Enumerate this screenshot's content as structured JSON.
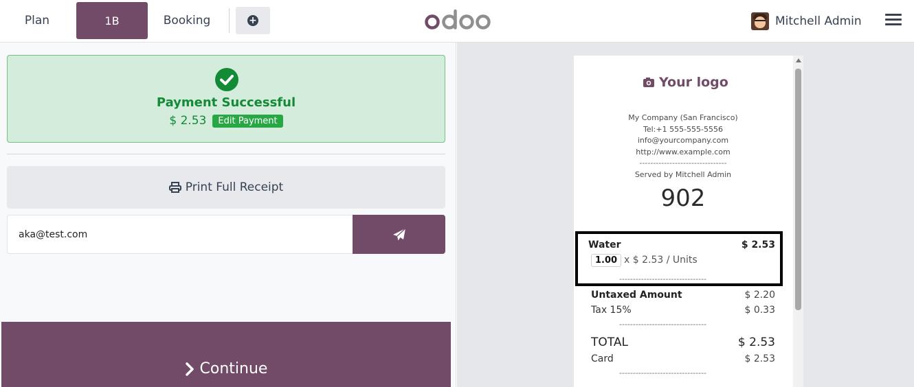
{
  "header": {
    "nav_plan": "Plan",
    "nav_table": "1B",
    "nav_booking": "Booking",
    "brand": "odoo",
    "user_name": "Mitchell Admin"
  },
  "payment": {
    "status": "Payment Successful",
    "amount": "$ 2.53",
    "edit_label": "Edit Payment",
    "print_label": "Print Full Receipt",
    "email_value": "aka@test.com",
    "continue_label": "Continue"
  },
  "receipt": {
    "logo_text": "Your logo",
    "company": "My Company (San Francisco)",
    "tel": "Tel:+1 555-555-5556",
    "email": "info@yourcompany.com",
    "website": "http://www.example.com",
    "dashes": "--------------------------------",
    "served_by": "Served by Mitchell Admin",
    "order_number": "902",
    "item": {
      "name": "Water",
      "price": "$ 2.53",
      "qty": "1.00",
      "unit_price": "x $ 2.53 / Units"
    },
    "untaxed_label": "Untaxed Amount",
    "untaxed_value": "$ 2.20",
    "tax_label": "Tax 15%",
    "tax_value": "$ 0.33",
    "total_label": "TOTAL",
    "total_value": "$ 2.53",
    "card_label": "Card",
    "card_value": "$ 2.53"
  },
  "colors": {
    "brand_purple": "#714b67",
    "success_green": "#138a36",
    "success_bg": "#d4ecdc"
  }
}
